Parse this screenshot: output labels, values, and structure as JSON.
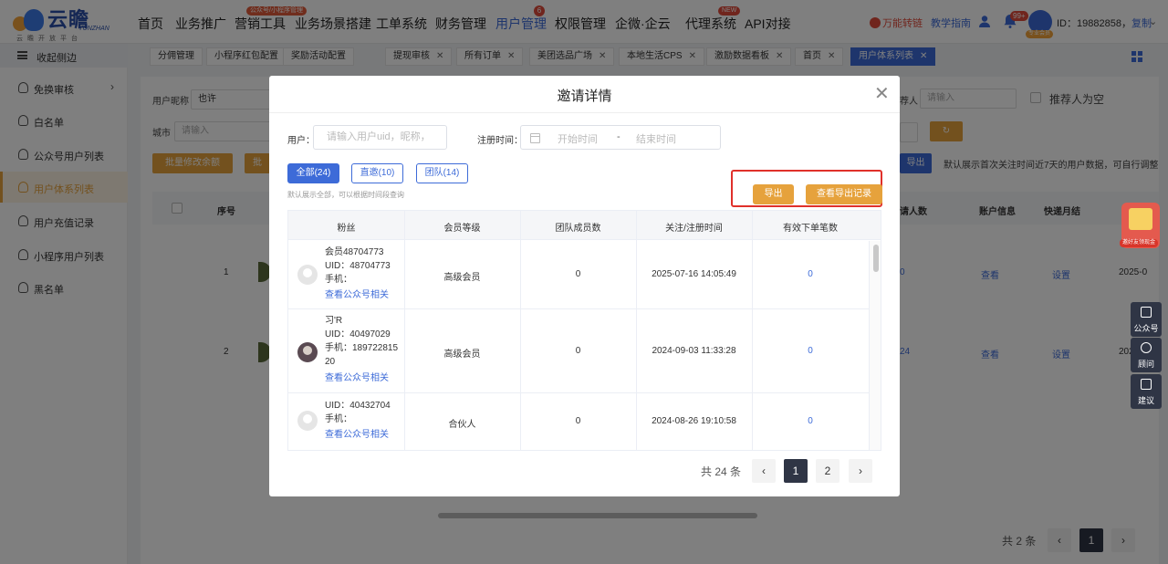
{
  "logo": {
    "name": "云瞻",
    "en": "YUNZHAN",
    "sub": "云瞻开放平台"
  },
  "nav": {
    "items": [
      "首页",
      "业务推广",
      "营销工具",
      "业务场景搭建",
      "工单系统",
      "财务管理",
      "用户管理",
      "权限管理",
      "企微·企云",
      "代理系统",
      "API对接"
    ],
    "active": "用户管理",
    "marketing_tag": "公众号/小程序管理",
    "user_mgmt_badge": "6",
    "agent_new_tag": "NEW"
  },
  "header_right": {
    "promo": "万能转链",
    "guide": "教学指南",
    "bell_badge": "99+",
    "avatar_tag": "专业会员",
    "id_label": "ID：19882858，",
    "copy": "复制"
  },
  "sidebar": {
    "collapse_label": "收起侧边",
    "items": [
      {
        "label": "免换审核",
        "has_arrow": true
      },
      {
        "label": "白名单"
      },
      {
        "label": "公众号用户列表"
      },
      {
        "label": "用户体系列表",
        "active": true
      },
      {
        "label": "用户充值记录"
      },
      {
        "label": "小程序用户列表"
      },
      {
        "label": "黑名单"
      }
    ]
  },
  "tabs": [
    {
      "label": "分佣管理"
    },
    {
      "label": "小程序红包配置"
    },
    {
      "label": "奖励活动配置"
    },
    {
      "label": "提现审核",
      "closable": true
    },
    {
      "label": "所有订单",
      "closable": true
    },
    {
      "label": "美团选品广场",
      "closable": true
    },
    {
      "label": "本地生活CPS",
      "closable": true
    },
    {
      "label": "激励数据看板",
      "closable": true
    },
    {
      "label": "首页",
      "closable": true
    },
    {
      "label": "用户体系列表",
      "closable": true,
      "active": true
    }
  ],
  "bg_page": {
    "nickname_label": "用户昵称",
    "nickname_value": "也许",
    "city_label": "城市",
    "city_placeholder": "请输入",
    "referrer_label": "荐人",
    "referrer_placeholder": "请输入",
    "referrer_empty_label": "推荐人为空",
    "batch_btn": "批量修改余额",
    "batch_btn2": "批",
    "export_btn": "导出",
    "note": "默认展示首次关注时间近7天的用户数据，可自行调整",
    "cols": [
      "序号",
      "请人数",
      "账户信息",
      "快递月结"
    ],
    "rows": [
      {
        "no": "1",
        "invite": "0",
        "account": "查看",
        "express": "设置",
        "date": "2025-0"
      },
      {
        "no": "2",
        "invite": "24",
        "account": "查看",
        "express": "设置",
        "date": "202"
      }
    ],
    "pager_total": "共 2 条",
    "pages": [
      "1"
    ]
  },
  "float_widgets": {
    "gift_label": "邀好友领现金",
    "buttons": [
      "公众号",
      "顾问",
      "建议"
    ]
  },
  "modal": {
    "title": "邀请详情",
    "user_label": "用户：",
    "user_placeholder": "请输入用户uid，昵称，",
    "reg_time_label": "注册时间：",
    "start_placeholder": "开始时间",
    "date_sep": "-",
    "end_placeholder": "结束时间",
    "segments": [
      "全部(24)",
      "直邀(10)",
      "团队(14)"
    ],
    "active_segment": "全部(24)",
    "hint": "默认展示全部，可以根据时间段查询",
    "export_btn": "导出",
    "export_history_btn": "查看导出记录",
    "columns": [
      "粉丝",
      "会员等级",
      "团队成员数",
      "关注/注册时间",
      "有效下单笔数"
    ],
    "rows": [
      {
        "fan_lines": [
          "会员48704773",
          "UID：48704773",
          "手机："
        ],
        "fan_link": "查看公众号相关",
        "level": "高级会员",
        "team": "0",
        "time": "2025-07-16 14:05:49",
        "orders": "0"
      },
      {
        "fan_lines": [
          "习'R",
          "UID：40497029",
          "手机：189722815",
          "20"
        ],
        "fan_link": "查看公众号相关",
        "level": "高级会员",
        "team": "0",
        "time": "2024-09-03 11:33:28",
        "orders": "0"
      },
      {
        "fan_lines": [
          "UID：40432704",
          "手机："
        ],
        "fan_link": "查看公众号相关",
        "level": "合伙人",
        "team": "0",
        "time": "2024-08-26 19:10:58",
        "orders": "0"
      }
    ],
    "pager_total": "共 24 条",
    "pages": [
      "1",
      "2"
    ],
    "current_page": "1"
  },
  "colors": {
    "primary": "#3d6bd8",
    "accent": "#e6a23c",
    "highlight": "#e0302a"
  }
}
